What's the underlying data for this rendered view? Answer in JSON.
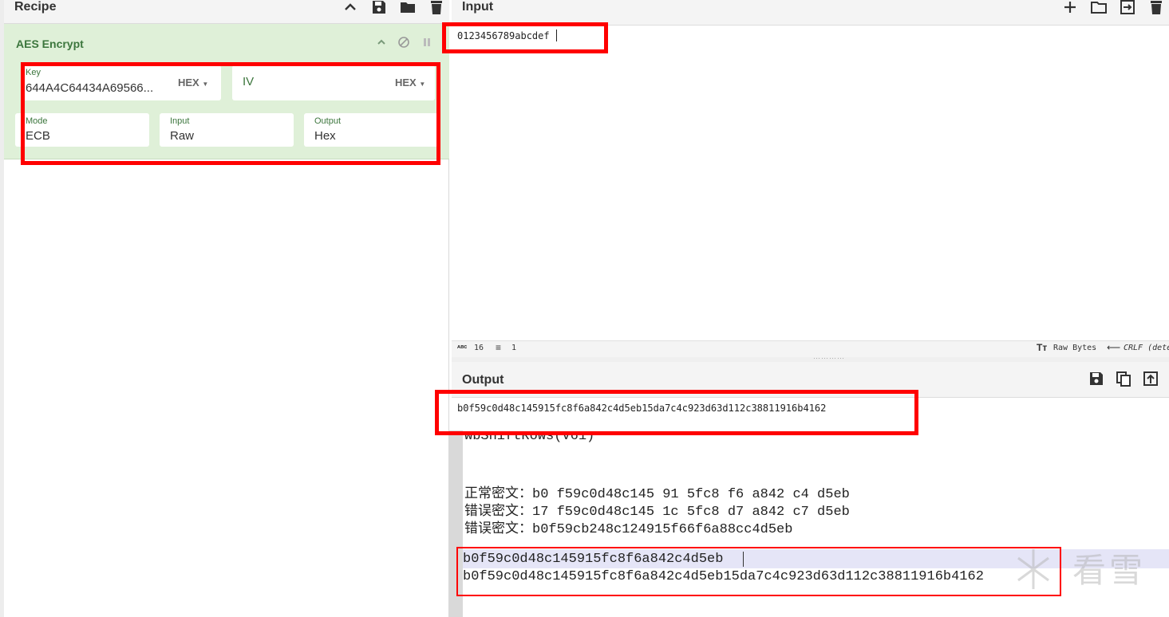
{
  "recipe": {
    "title": "Recipe",
    "icons": [
      "chevron-up-icon",
      "save-icon",
      "folder-icon",
      "trash-icon"
    ]
  },
  "operation": {
    "title": "AES Encrypt",
    "key": {
      "label": "Key",
      "value": "644A4C64434A69566...",
      "format": "HEX"
    },
    "iv": {
      "label": "IV",
      "value": "",
      "format": "HEX"
    },
    "mode": {
      "label": "Mode",
      "value": "ECB"
    },
    "input": {
      "label": "Input",
      "value": "Raw"
    },
    "output": {
      "label": "Output",
      "value": "Hex"
    }
  },
  "input_pane": {
    "title": "Input",
    "text": "0123456789abcdef",
    "icons": [
      "plus-icon",
      "folder-icon",
      "import-icon",
      "trash-icon"
    ]
  },
  "status_bar": {
    "char_icon": "ᴀʙᴄ",
    "chars": "16",
    "lines": "1",
    "encoding": "Raw Bytes",
    "eol": "CRLF (dete"
  },
  "output_pane": {
    "title": "Output",
    "text": "b0f59c0d48c145915fc8f6a842c4d5eb15da7c4c923d63d112c38811916b4162",
    "icons": [
      "save-icon",
      "copy-icon",
      "replace-input-icon"
    ]
  },
  "background_doc": {
    "partial_line": "wbShiftRows(V61)",
    "line1": "正常密文：b0 f59c0d48c145 91 5fc8 f6 a842 c4 d5eb",
    "line2": "错误密文：17 f59c0d48c145 1c 5fc8 d7 a842 c7 d5eb",
    "line3": "错误密文：b0f59cb248c124915f66f6a88cc4d5eb",
    "line4": "b0f59c0d48c145915fc8f6a842c4d5eb",
    "line5": "b0f59c0d48c145915fc8f6a842c4d5eb15da7c4c923d63d112c38811916b4162"
  },
  "watermark": "看雪",
  "colors": {
    "accent_green": "#3c763d",
    "op_bg": "#dff0d8",
    "highlight": "#ff0000"
  }
}
